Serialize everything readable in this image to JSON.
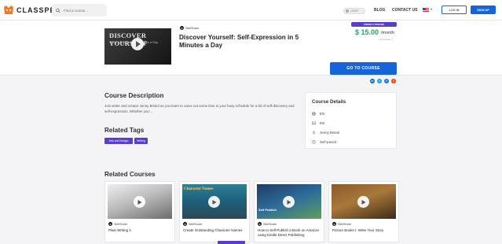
{
  "brand": {
    "name": "CLASSPERT",
    "color": "#f47a2a"
  },
  "nav": {
    "search_placeholder": "Find a course...",
    "toggle_label": "LIGHT",
    "links": [
      "BLOG",
      "CONTACT US"
    ],
    "login_label": "LOG IN",
    "signup_label": "SIGN UP",
    "accent": "#1565d8"
  },
  "course": {
    "thumb_title": "DISCOVER YOURSELF",
    "thumb_subtitle": "Self-Expression in 5 Minutes a Day",
    "provider": "SkillShare",
    "title": "Discover Yourself: Self-Expression in 5 Minutes a Day",
    "badge": "UNDER 5 PRICING",
    "price": "$ 15.00",
    "per": "/month",
    "price_note": "+ All Courses ⓘ",
    "cta": "GO TO COURSE",
    "share_icons": [
      "linkedin-icon",
      "twitter-icon",
      "facebook-icon",
      "reddit-icon"
    ]
  },
  "description": {
    "heading": "Course Description",
    "text": "Join writer and creator Jenny Bristol as you learn to carve out some time in your busy schedule for a bit of self-discovery and self-expression. Whether you'...",
    "tags_heading": "Related Tags",
    "tags": [
      "Arts and Design",
      "Writing"
    ]
  },
  "details": {
    "heading": "Course Details",
    "rows": [
      {
        "icon": "globe-icon",
        "value": "EN"
      },
      {
        "icon": "subtitles-icon",
        "value": "EN"
      },
      {
        "icon": "instructor-icon",
        "value": "Jenny Bristol"
      },
      {
        "icon": "clock-icon",
        "value": "Self-paced"
      }
    ]
  },
  "related": {
    "heading": "Related Courses",
    "cards": [
      {
        "provider": "SkillShare",
        "title": "Plain Writing 1",
        "caption": ""
      },
      {
        "provider": "SkillShare",
        "title": "Create Outstanding Character Names",
        "caption": "Character Names"
      },
      {
        "provider": "SkillShare",
        "title": "How to Self Publish a Book on Amazon using Kindle Direct Publishing",
        "caption": "Self Publish"
      },
      {
        "provider": "SkillShare",
        "title": "Picture Books I: Write Your Story",
        "caption": ""
      }
    ]
  }
}
